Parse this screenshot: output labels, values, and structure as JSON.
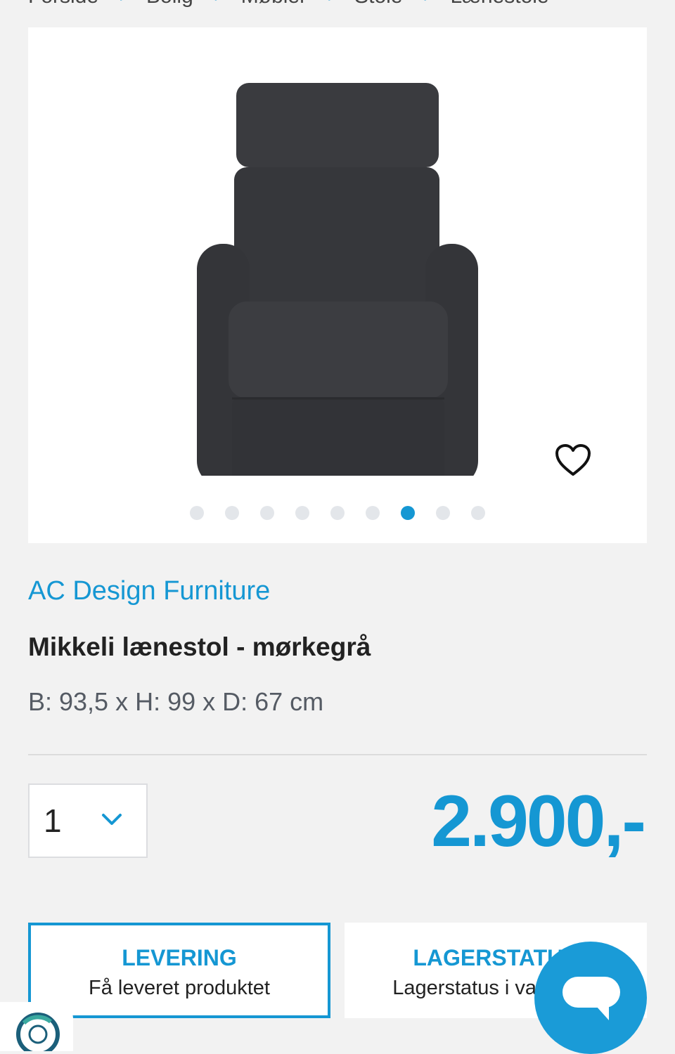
{
  "breadcrumb": [
    "Forside",
    "Bolig",
    "Møbler",
    "Stole",
    "Lænestole"
  ],
  "gallery": {
    "image_alt": "Mikkeli lænestol - mørkegrå",
    "dot_count": 9,
    "active_dot": 7
  },
  "product": {
    "brand": "AC Design Furniture",
    "title": "Mikkeli lænestol - mørkegrå",
    "dimensions": "B: 93,5 x H: 99 x D: 67 cm",
    "quantity": "1",
    "price": "2.900,-"
  },
  "cards": {
    "delivery": {
      "title": "LEVERING",
      "subtitle": "Få leveret produktet"
    },
    "stock": {
      "title": "LAGERSTATUS",
      "subtitle": "Lagerstatus i varehuse"
    }
  },
  "icons": {
    "favorite": "heart-icon",
    "quantity": "chevron-down-icon",
    "chat": "chat-icon",
    "badge": "trust-badge-icon"
  },
  "colors": {
    "accent": "#1597d3",
    "background": "#f2f2f2",
    "dot_inactive": "#e3e6ea"
  }
}
